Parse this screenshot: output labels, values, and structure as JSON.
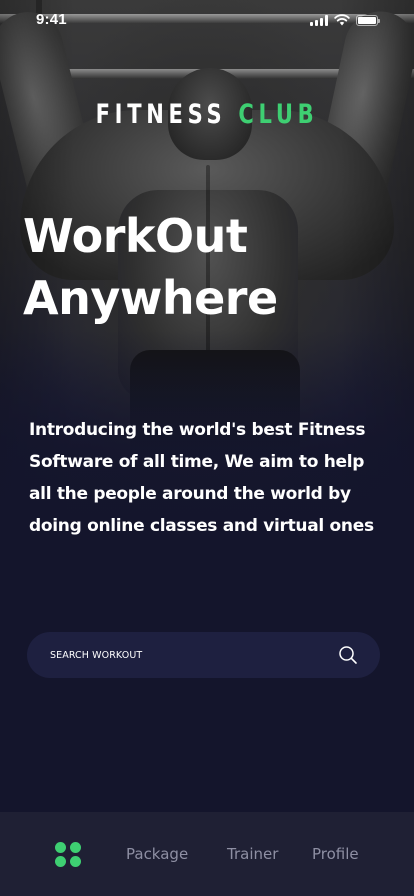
{
  "status_bar": {
    "time": "9:41",
    "icons": [
      "cellular-signal-icon",
      "wifi-icon",
      "battery-icon"
    ]
  },
  "brand": {
    "part1": "FITNESS",
    "part2": "CLUB",
    "accent_color": "#3ecf72"
  },
  "hero": {
    "title_line1": "WorkOut",
    "title_line2": "Anywhere"
  },
  "intro": {
    "text": "Introducing the world's best Fitness Software of all time, We aim to help all the people around the world by doing online classes and virtual ones"
  },
  "search": {
    "placeholder": "SEARCH WORKOUT",
    "icon": "search-icon"
  },
  "bottom_nav": {
    "home_icon": "grid-dots-icon",
    "items": [
      {
        "label": "Package"
      },
      {
        "label": "Trainer"
      },
      {
        "label": "Profile"
      }
    ]
  },
  "colors": {
    "background": "#14152c",
    "search_bg": "#1e2040",
    "nav_bg": "#1f2034",
    "accent": "#3ecf72",
    "nav_text": "#8e8fa3"
  }
}
